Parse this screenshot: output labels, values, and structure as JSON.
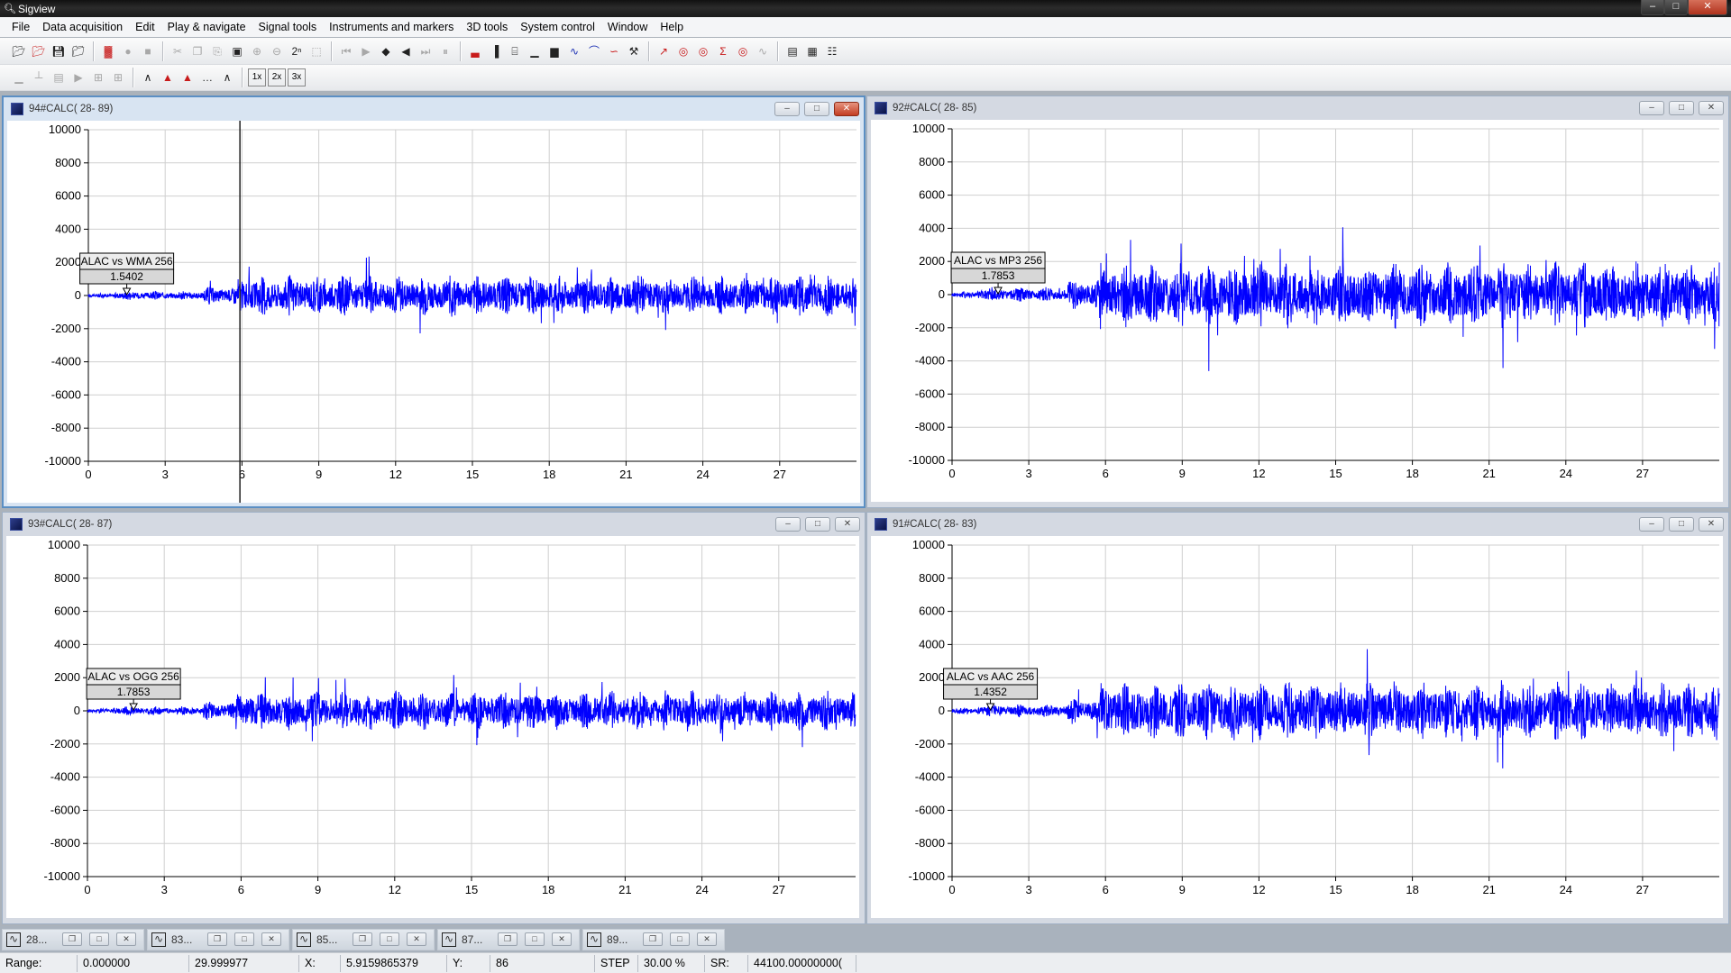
{
  "app": {
    "title": "Sigview",
    "icon": "magnifier-icon"
  },
  "menu": [
    "File",
    "Data acquisition",
    "Edit",
    "Play & navigate",
    "Signal tools",
    "Instruments and markers",
    "3D tools",
    "System control",
    "Window",
    "Help"
  ],
  "toolbar1": {
    "group1": [
      "open-icon",
      "open-recent-icon",
      "save-icon",
      "save-as-icon"
    ],
    "group2": [
      "record-wave-icon",
      "rec-icon",
      "stop-icon"
    ],
    "group3": [
      "cut-icon",
      "copy-icon",
      "paste-icon",
      "zoom-area-icon",
      "zoom-in-icon",
      "zoom-out-icon",
      "zoom-power-icon",
      "zoom-reset-icon"
    ],
    "group4": [
      "first-icon",
      "play-icon",
      "prev-marker-icon",
      "next-marker-icon",
      "last-icon",
      "pause-icon"
    ],
    "group5": [
      "spectrum-icon",
      "histogram-icon",
      "calculator-icon",
      "bars-icon",
      "yellow-bars-icon",
      "wave-filter-icon",
      "envelope-icon",
      "derivative-icon",
      "tools-icon"
    ],
    "group6": [
      "max-icon",
      "min-icon",
      "stdv-icon",
      "sum-icon",
      "rms-icon",
      "wave-analysis-icon"
    ],
    "group7": [
      "tile-icon",
      "cascade-icon",
      "tree-icon"
    ]
  },
  "toolbar2": {
    "group1": [
      "chart-type-1-icon",
      "chart-type-2-icon",
      "chart-type-3-icon",
      "chart-type-4-icon",
      "grid-1-icon",
      "grid-2-icon"
    ],
    "group2": [
      "line-style-1-icon",
      "line-style-2-icon",
      "line-style-3-icon",
      "line-style-4-icon",
      "line-style-5-icon"
    ],
    "group3": [
      "scale-1x",
      "scale-2x",
      "scale-3x"
    ],
    "scale_labels": [
      "1x",
      "2x",
      "3x"
    ]
  },
  "windows": [
    {
      "title": "94#CALC( 28- 89)",
      "active": true,
      "label": "ALAC vs WMA 256",
      "value": "1.5402"
    },
    {
      "title": "92#CALC( 28- 85)",
      "active": false,
      "label": "ALAC vs MP3 256",
      "value": "1.7853"
    },
    {
      "title": "93#CALC( 28- 87)",
      "active": false,
      "label": "ALAC vs OGG 256",
      "value": "1.7853"
    },
    {
      "title": "91#CALC( 28- 83)",
      "active": false,
      "label": "ALAC vs AAC 256",
      "value": "1.4352"
    }
  ],
  "chart_data": [
    {
      "type": "line",
      "window": "94#CALC( 28- 89)",
      "x_ticks": [
        "0",
        "3",
        "6",
        "9",
        "12",
        "15",
        "18",
        "21",
        "24",
        "27"
      ],
      "y_ticks": [
        "10000",
        "8000",
        "6000",
        "4000",
        "2000",
        "0",
        "-2000",
        "-4000",
        "-6000",
        "-8000",
        "-10000"
      ],
      "xlim": [
        0,
        30
      ],
      "ylim": [
        -10000,
        10000
      ],
      "grid": true,
      "series": [
        {
          "color": "#0000ff",
          "amplitude": 1500
        }
      ],
      "cursor_x": 5.92,
      "marker": {
        "x": 1.5,
        "y": 0,
        "label": "ALAC vs WMA 256",
        "value": "1.5402"
      }
    },
    {
      "type": "line",
      "window": "92#CALC( 28- 85)",
      "x_ticks": [
        "0",
        "3",
        "6",
        "9",
        "12",
        "15",
        "18",
        "21",
        "24",
        "27"
      ],
      "y_ticks": [
        "10000",
        "8000",
        "6000",
        "4000",
        "2000",
        "0",
        "-2000",
        "-4000",
        "-6000",
        "-8000",
        "-10000"
      ],
      "xlim": [
        0,
        30
      ],
      "ylim": [
        -10000,
        10000
      ],
      "grid": true,
      "series": [
        {
          "color": "#0000ff",
          "amplitude": 2500
        }
      ],
      "marker": {
        "x": 1.8,
        "y": 0,
        "label": "ALAC vs MP3 256",
        "value": "1.7853"
      }
    },
    {
      "type": "line",
      "window": "93#CALC( 28- 87)",
      "x_ticks": [
        "0",
        "3",
        "6",
        "9",
        "12",
        "15",
        "18",
        "21",
        "24",
        "27"
      ],
      "y_ticks": [
        "10000",
        "8000",
        "6000",
        "4000",
        "2000",
        "0",
        "-2000",
        "-4000",
        "-6000",
        "-8000",
        "-10000"
      ],
      "xlim": [
        0,
        30
      ],
      "ylim": [
        -10000,
        10000
      ],
      "grid": true,
      "series": [
        {
          "color": "#0000ff",
          "amplitude": 1500
        }
      ],
      "marker": {
        "x": 1.8,
        "y": 0,
        "label": "ALAC vs OGG 256",
        "value": "1.7853"
      }
    },
    {
      "type": "line",
      "window": "91#CALC( 28- 83)",
      "x_ticks": [
        "0",
        "3",
        "6",
        "9",
        "12",
        "15",
        "18",
        "21",
        "24",
        "27"
      ],
      "y_ticks": [
        "10000",
        "8000",
        "6000",
        "4000",
        "2000",
        "0",
        "-2000",
        "-4000",
        "-6000",
        "-8000",
        "-10000"
      ],
      "xlim": [
        0,
        30
      ],
      "ylim": [
        -10000,
        10000
      ],
      "grid": true,
      "series": [
        {
          "color": "#0000ff",
          "amplitude": 2200
        }
      ],
      "marker": {
        "x": 1.5,
        "y": 0,
        "label": "ALAC vs AAC 256",
        "value": "1.4352"
      }
    }
  ],
  "taskbar": [
    {
      "label": "28...",
      "icon": "signal-window-icon"
    },
    {
      "label": "83...",
      "icon": "signal-window-icon"
    },
    {
      "label": "85...",
      "icon": "signal-window-icon"
    },
    {
      "label": "87...",
      "icon": "signal-window-icon"
    },
    {
      "label": "89...",
      "icon": "signal-window-icon"
    }
  ],
  "status": {
    "range_label": "Range:",
    "range_start": "0.000000",
    "range_end": "29.999977",
    "x_label": "X:",
    "x_value": "5.9159865379",
    "y_label": "Y:",
    "y_value": "86",
    "step_label": "STEP",
    "step_value": "30.00 %",
    "sr_label": "SR:",
    "sr_value": "44100.00000000("
  }
}
